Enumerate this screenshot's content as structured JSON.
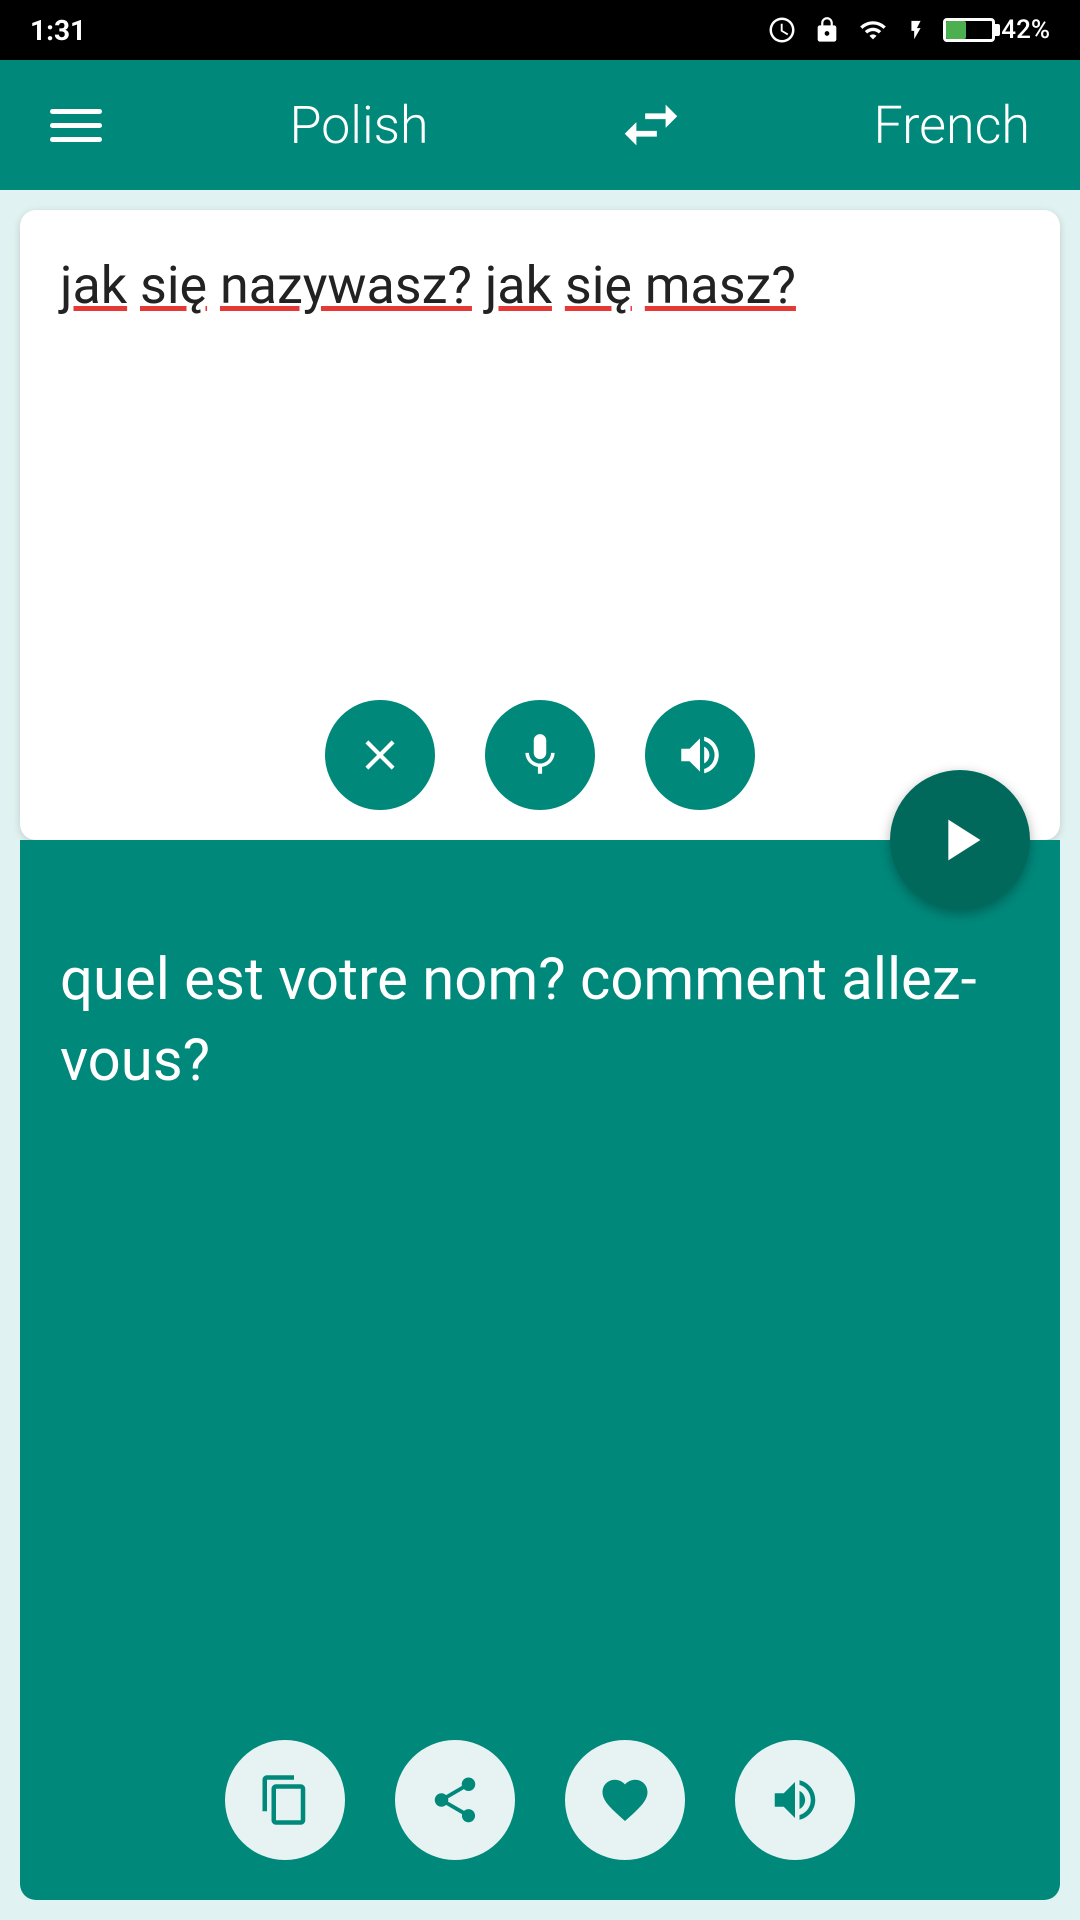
{
  "statusBar": {
    "time": "1:31",
    "battery": "42%",
    "batteryPercent": 42
  },
  "navBar": {
    "sourceLang": "Polish",
    "targetLang": "French"
  },
  "inputSection": {
    "text": "jak się nazywasz? jak się masz?",
    "clearLabel": "clear",
    "micLabel": "microphone",
    "speakLabel": "speak input"
  },
  "outputSection": {
    "text": "quel est votre nom? comment allez-vous?",
    "copyLabel": "copy",
    "shareLabel": "share",
    "favoriteLabel": "favorite",
    "speakLabel": "speak output"
  },
  "translateButton": {
    "label": "translate"
  }
}
